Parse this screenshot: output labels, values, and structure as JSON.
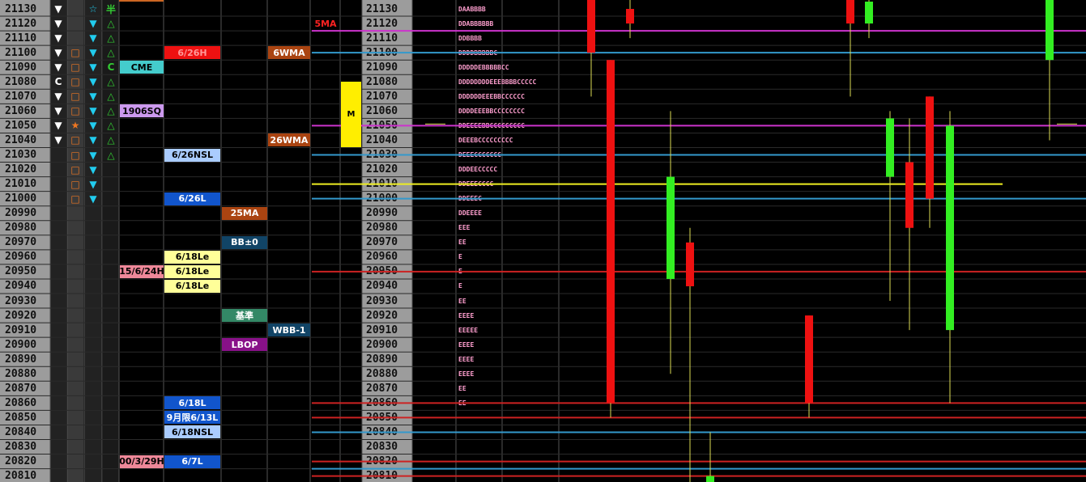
{
  "colors": {
    "panel_gray": "#9c9c9c",
    "up_candle": "#33ee22",
    "down_candle": "#ee1111",
    "magenta_line": "#cc33cc",
    "blue_line": "#3399cc",
    "red_line": "#cc2222",
    "yellow_line": "#eeee22"
  },
  "chart_data": {
    "type": "candlestick",
    "y_tick_step": 10,
    "ylim": [
      20805,
      21135
    ],
    "price_ticks": [
      21130,
      21120,
      21110,
      21100,
      21090,
      21080,
      21070,
      21060,
      21050,
      21040,
      21030,
      21020,
      21010,
      21000,
      20990,
      20980,
      20970,
      20960,
      20950,
      20940,
      20930,
      20920,
      20910,
      20900,
      20890,
      20880,
      20870,
      20860,
      20850,
      20840,
      20830,
      20820,
      20810
    ],
    "annotation_5ma": "5MA",
    "volume_marker": {
      "label": "M",
      "from": 21075,
      "to": 21035
    },
    "candles": [
      {
        "open": 21140,
        "close": 21100,
        "high": 21140,
        "low": 21070
      },
      {
        "open": 21130,
        "close": 21120,
        "high": 21140,
        "low": 21110
      },
      {
        "open": 21095,
        "close": 20860,
        "high": 21095,
        "low": 20850
      },
      {
        "open": 20945,
        "close": 21015,
        "high": 21060,
        "low": 20880
      },
      {
        "open": 20970,
        "close": 20940,
        "high": 20980,
        "low": 20790
      },
      {
        "open": 20790,
        "close": 20810,
        "high": 20840,
        "low": 20780
      },
      {
        "open": 20920,
        "close": 20860,
        "high": 20920,
        "low": 20850
      },
      {
        "open": 21140,
        "close": 21120,
        "high": 21140,
        "low": 21070
      },
      {
        "open": 21120,
        "close": 21135,
        "high": 21140,
        "low": 21110
      },
      {
        "open": 21015,
        "close": 21055,
        "high": 21060,
        "low": 20930
      },
      {
        "open": 21025,
        "close": 20980,
        "high": 21055,
        "low": 20910
      },
      {
        "open": 21070,
        "close": 21000,
        "high": 21070,
        "low": 20980
      },
      {
        "open": 20910,
        "close": 21050,
        "high": 21060,
        "low": 20860
      },
      {
        "open": 21095,
        "close": 21140,
        "high": 21140,
        "low": 21040
      }
    ],
    "levels": [
      {
        "price": 21115,
        "color": "magenta"
      },
      {
        "price": 21100,
        "color": "blue"
      },
      {
        "price": 21050,
        "color": "magenta"
      },
      {
        "price": 21030,
        "color": "blue"
      },
      {
        "price": 21010,
        "color": "yellow"
      },
      {
        "price": 21000,
        "color": "blue"
      },
      {
        "price": 20950,
        "color": "red"
      },
      {
        "price": 20860,
        "color": "red"
      },
      {
        "price": 20850,
        "color": "red"
      },
      {
        "price": 20840,
        "color": "blue"
      },
      {
        "price": 20820,
        "color": "red"
      },
      {
        "price": 20815,
        "color": "blue"
      },
      {
        "price": 20810,
        "color": "red"
      }
    ]
  },
  "tpo_profile": [
    {
      "price": 21130,
      "text": "DAABBBB"
    },
    {
      "price": 21120,
      "text": "DDABBBBBB"
    },
    {
      "price": 21110,
      "text": "DDBBBB"
    },
    {
      "price": 21100,
      "text": "DDDDBBBBBC"
    },
    {
      "price": 21090,
      "text": "DDDDDEBBBBBCC"
    },
    {
      "price": 21080,
      "text": "DDDDDDDDEEEBBBBCCCCC"
    },
    {
      "price": 21070,
      "text": "DDDDDDEEEBBCCCCCC"
    },
    {
      "price": 21060,
      "text": "DDDDEEEBBCCCCCCCC"
    },
    {
      "price": 21050,
      "text": "DDEEEEBBCCCCCCCCC"
    },
    {
      "price": 21040,
      "text": "DEEEBCCCCCCCCC"
    },
    {
      "price": 21030,
      "text": "DEEECCCCCCC"
    },
    {
      "price": 21020,
      "text": "DDDEECCCCC"
    },
    {
      "price": 21010,
      "text": "DDEEECCCC"
    },
    {
      "price": 21000,
      "text": "DDEEEC"
    },
    {
      "price": 20990,
      "text": "DDEEEE"
    },
    {
      "price": 20980,
      "text": "EEE"
    },
    {
      "price": 20970,
      "text": "EE"
    },
    {
      "price": 20960,
      "text": "E"
    },
    {
      "price": 20950,
      "text": "E"
    },
    {
      "price": 20940,
      "text": "E"
    },
    {
      "price": 20930,
      "text": "EE"
    },
    {
      "price": 20920,
      "text": "EEEE"
    },
    {
      "price": 20910,
      "text": "EEEEE"
    },
    {
      "price": 20900,
      "text": "EEEE"
    },
    {
      "price": 20890,
      "text": "EEEE"
    },
    {
      "price": 20880,
      "text": "EEEE"
    },
    {
      "price": 20870,
      "text": "EE"
    },
    {
      "price": 20860,
      "text": "EE"
    }
  ],
  "left_icons": [
    {
      "price": 21130,
      "c1": "tri-down-white",
      "c2": "",
      "c3": "star-outline",
      "c4": "半"
    },
    {
      "price": 21120,
      "c1": "tri-down-white",
      "c2": "",
      "c3": "tri-down-cyan",
      "c4": "tri-up-green"
    },
    {
      "price": 21110,
      "c1": "tri-down-white",
      "c2": "",
      "c3": "tri-down-cyan",
      "c4": "tri-up-green"
    },
    {
      "price": 21100,
      "c1": "tri-down-white",
      "c2": "square-orange",
      "c3": "tri-down-cyan",
      "c4": "tri-up-green"
    },
    {
      "price": 21090,
      "c1": "tri-down-white",
      "c2": "square-orange",
      "c3": "tri-down-cyan",
      "c4": "C"
    },
    {
      "price": 21080,
      "c1": "C",
      "c2": "square-orange",
      "c3": "tri-down-cyan",
      "c4": "tri-up-green"
    },
    {
      "price": 21070,
      "c1": "tri-down-white",
      "c2": "square-orange",
      "c3": "tri-down-cyan",
      "c4": "tri-up-green"
    },
    {
      "price": 21060,
      "c1": "tri-down-white",
      "c2": "square-orange",
      "c3": "tri-down-cyan",
      "c4": "tri-up-green"
    },
    {
      "price": 21050,
      "c1": "tri-down-white",
      "c2": "star-orange",
      "c3": "tri-down-cyan",
      "c4": "tri-up-green"
    },
    {
      "price": 21040,
      "c1": "tri-down-white",
      "c2": "square-orange",
      "c3": "tri-down-cyan",
      "c4": "tri-up-green"
    },
    {
      "price": 21030,
      "c1": "",
      "c2": "square-orange",
      "c3": "tri-down-cyan",
      "c4": "tri-up-green"
    },
    {
      "price": 21020,
      "c1": "",
      "c2": "square-orange",
      "c3": "tri-down-cyan",
      "c4": ""
    },
    {
      "price": 21010,
      "c1": "",
      "c2": "square-orange",
      "c3": "tri-down-cyan",
      "c4": ""
    },
    {
      "price": 21000,
      "c1": "",
      "c2": "square-orange",
      "c3": "tri-down-cyan",
      "c4": ""
    }
  ],
  "labels": [
    {
      "col": 0,
      "price": 21090,
      "text": "CME",
      "bg": "#44cccc",
      "fg": "#000000"
    },
    {
      "col": 0,
      "price": 21060,
      "text": "1906SQ",
      "bg": "#cc99ee",
      "fg": "#000000"
    },
    {
      "col": 0,
      "price": 20950,
      "text": "15/6/24H",
      "bg": "#ee8899",
      "fg": "#000000"
    },
    {
      "col": 0,
      "price": 20820,
      "text": "00/3/29H",
      "bg": "#ee8899",
      "fg": "#000000"
    },
    {
      "col": 1,
      "price": 21100,
      "text": "6/26H",
      "bg": "#ee1111",
      "fg": "#ff9999"
    },
    {
      "col": 1,
      "price": 21030,
      "text": "6/26NSL",
      "bg": "#aaccff",
      "fg": "#000000"
    },
    {
      "col": 1,
      "price": 21000,
      "text": "6/26L",
      "bg": "#1155cc",
      "fg": "#ffffff"
    },
    {
      "col": 1,
      "price": 20960,
      "text": "6/18Le",
      "bg": "#ffff99",
      "fg": "#000000"
    },
    {
      "col": 1,
      "price": 20950,
      "text": "6/18Le",
      "bg": "#ffff99",
      "fg": "#000000"
    },
    {
      "col": 1,
      "price": 20940,
      "text": "6/18Le",
      "bg": "#ffff99",
      "fg": "#000000"
    },
    {
      "col": 1,
      "price": 20860,
      "text": "6/18L",
      "bg": "#1155cc",
      "fg": "#ffffff"
    },
    {
      "col": 1,
      "price": 20850,
      "text": "9月限6/13L",
      "bg": "#1155cc",
      "fg": "#ffffff"
    },
    {
      "col": 1,
      "price": 20840,
      "text": "6/18NSL",
      "bg": "#aaccff",
      "fg": "#000000"
    },
    {
      "col": 1,
      "price": 20820,
      "text": "6/7L",
      "bg": "#1155cc",
      "fg": "#ffffff"
    },
    {
      "col": 2,
      "price": 20990,
      "text": "25MA",
      "bg": "#aa4411",
      "fg": "#ffffff"
    },
    {
      "col": 2,
      "price": 20970,
      "text": "BB±0",
      "bg": "#114466",
      "fg": "#ffffff"
    },
    {
      "col": 2,
      "price": 20920,
      "text": "基準",
      "bg": "#338866",
      "fg": "#ffffff"
    },
    {
      "col": 2,
      "price": 20900,
      "text": "LBOP",
      "bg": "#881188",
      "fg": "#ffffff"
    },
    {
      "col": 3,
      "price": 21100,
      "text": "6WMA",
      "bg": "#aa4411",
      "fg": "#ffffff"
    },
    {
      "col": 3,
      "price": 21040,
      "text": "26WMA",
      "bg": "#aa4411",
      "fg": "#ffffff"
    },
    {
      "col": 3,
      "price": 20910,
      "text": "WBB-1",
      "bg": "#114466",
      "fg": "#ffffff"
    }
  ]
}
